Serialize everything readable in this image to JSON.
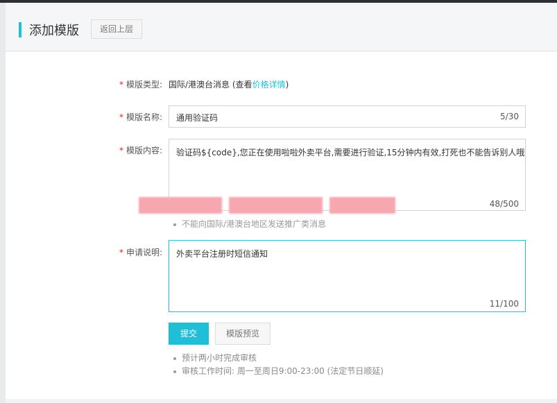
{
  "header": {
    "title": "添加模版",
    "back_label": "返回上层"
  },
  "form": {
    "type": {
      "required_mark": "*",
      "label": "模版类型:",
      "value": "国际/港澳台消息",
      "paren_open": "(查看",
      "price_link": "价格详情",
      "paren_close": ")"
    },
    "name": {
      "required_mark": "*",
      "label": "模版名称:",
      "value": "通用验证码",
      "counter": "5/30"
    },
    "content": {
      "required_mark": "*",
      "label": "模版内容:",
      "value": "验证码${code},您正在使用啦啦外卖平台,需要进行验证,15分钟内有效,打死也不能告诉别人哦",
      "counter": "48/500",
      "tip_partial": "不能向国际/港澳台地区发送推广类消息"
    },
    "application": {
      "required_mark": "*",
      "label": "申请说明:",
      "value": "外卖平台注册时短信通知",
      "counter": "11/100"
    }
  },
  "actions": {
    "submit_label": "提交",
    "preview_label": "模版预览"
  },
  "notes": [
    "预计两小时完成审核",
    "审核工作时间: 周一至周日9:00-23:00 (法定节日顺延)"
  ],
  "colors": {
    "accent": "#1fbfd7",
    "required": "#e02020"
  }
}
